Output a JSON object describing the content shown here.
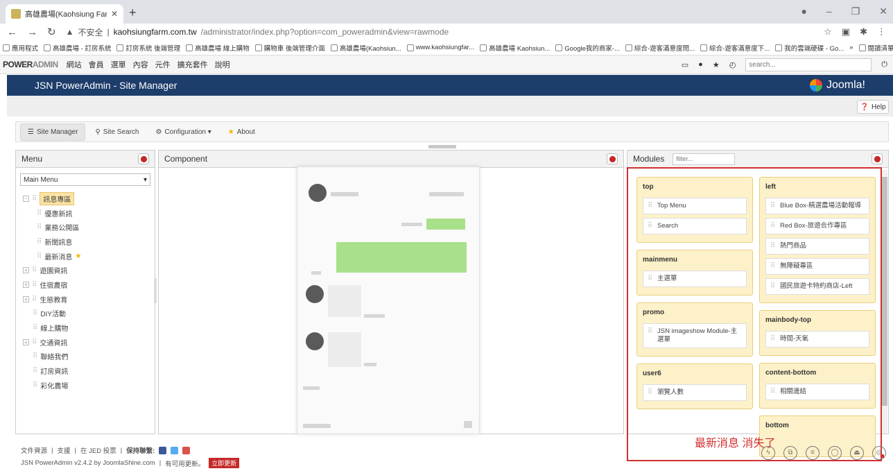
{
  "browser": {
    "tab_title": "高雄農場(Kaohsiung Farm) - 管...",
    "address_warning": "不安全",
    "address_host": "kaohsiungfarm.com.tw",
    "address_path": "/administrator/index.php?option=com_poweradmin&view=rawmode",
    "bookmarks": [
      "應用程式",
      "高雄農場 - 訂房系統",
      "訂房系統 後端管理",
      "高雄農場 線上購物",
      "購物車 後端管理介面",
      "高雄農場(Kaohsiun...",
      "www.kaohsiungfar...",
      "高雄農場 Kaohsiun...",
      "Google我的商家-...",
      "綜合-遊客滿意度問...",
      "綜合-遊客滿意度下...",
      "我的雲端硬碟 - Go..."
    ],
    "bookmarks_more": "»",
    "reading_list": "閱讀清單"
  },
  "adminbar": {
    "logo_power": "POWER",
    "logo_admin": "ADMIN",
    "menu": [
      "網站",
      "會員",
      "選單",
      "內容",
      "元件",
      "擴充套件",
      "說明"
    ],
    "search_placeholder": "search..."
  },
  "title": {
    "text": "JSN PowerAdmin - Site Manager",
    "joomla": "Joomla!"
  },
  "toolbar": {
    "help": "Help"
  },
  "subnav": [
    "Site Manager",
    "Site Search",
    "Configuration ▾",
    "About"
  ],
  "menu_panel": {
    "title": "Menu",
    "selected_menu": "Main Menu",
    "items": [
      {
        "label": "訊息專區",
        "selected": true
      },
      {
        "label": "優惠新訊",
        "child": true
      },
      {
        "label": "業務公開區",
        "child": true
      },
      {
        "label": "新聞訊息",
        "child": true
      },
      {
        "label": "最新消息",
        "child": true,
        "star": true
      },
      {
        "label": "遊園資訊"
      },
      {
        "label": "住宿農宿"
      },
      {
        "label": "生態教育"
      },
      {
        "label": "DIY活動"
      },
      {
        "label": "線上購物"
      },
      {
        "label": "交通資訊"
      },
      {
        "label": "聯絡我們"
      },
      {
        "label": "訂房資訊"
      },
      {
        "label": "彩化農場"
      }
    ]
  },
  "component_panel": {
    "title": "Component"
  },
  "modules_panel": {
    "title": "Modules",
    "filter_placeholder": "filter...",
    "left_col": [
      {
        "position": "top",
        "modules": [
          "Top Menu",
          "Search"
        ]
      },
      {
        "position": "mainmenu",
        "modules": [
          "主選單"
        ]
      },
      {
        "position": "promo",
        "modules": [
          "JSN imageshow Module-主選單"
        ]
      },
      {
        "position": "user6",
        "modules": [
          "瀏覽人數"
        ]
      }
    ],
    "right_col": [
      {
        "position": "left",
        "modules": [
          "Blue Box-精選農場活動報導",
          "Red Box-旅遊合作專區",
          "熱門商品",
          "無障礙專區",
          "國民旅遊卡特約商店-Left"
        ]
      },
      {
        "position": "mainbody-top",
        "modules": [
          "時間-天氣"
        ]
      },
      {
        "position": "content-bottom",
        "modules": [
          "相關連結"
        ]
      },
      {
        "position": "bottom",
        "modules": []
      }
    ]
  },
  "annotation": "最新消息 消失了",
  "footer": {
    "links": [
      "文件資源",
      "支援",
      "在 JED 投票",
      "保持聯繫:"
    ],
    "version": "JSN PowerAdmin v2.4.2 by JoomlaShine.com",
    "update_note": "有可用更新。",
    "update_button": "立即更新"
  },
  "colors": {
    "navy": "#1d3d6b",
    "annotation_red": "#d32f2f",
    "position_yellow": "#fdf1c9"
  }
}
